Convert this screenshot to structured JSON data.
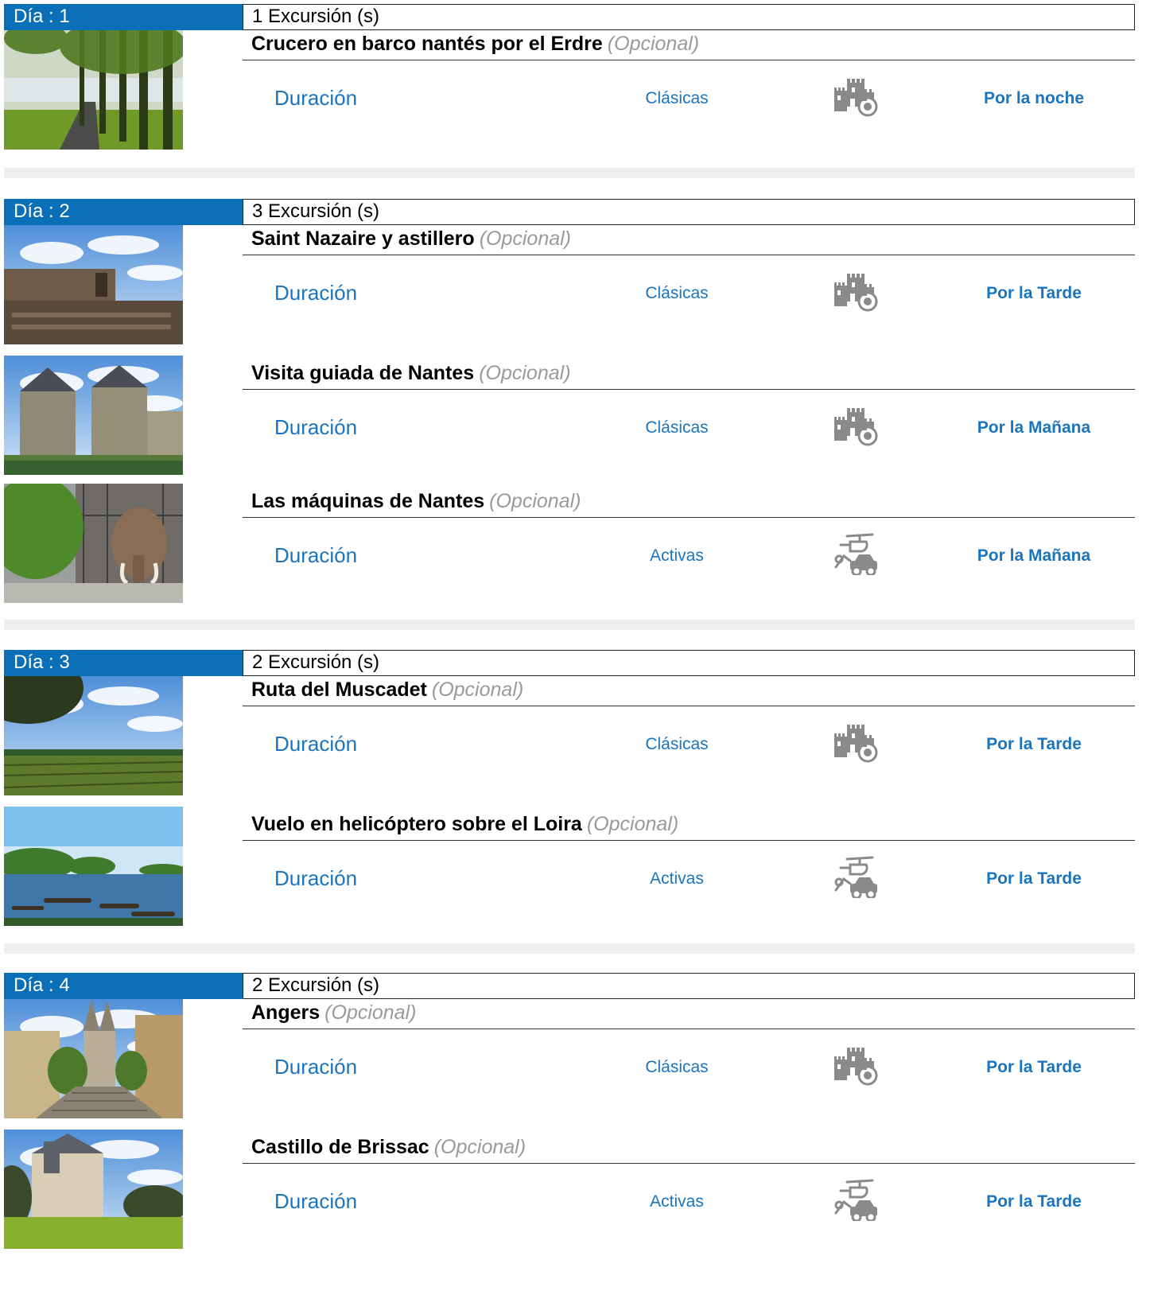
{
  "days": [
    {
      "label": "Día : 1",
      "count": "1 Excursión (s)",
      "excursions": [
        {
          "name": "Crucero en barco nantés por el Erdre",
          "optional": "(Opcional)",
          "duration": "Duración",
          "category": "Clásicas",
          "category_icon": "castle-camera-icon",
          "time": "Por la noche",
          "image": "river-path-trees"
        }
      ]
    },
    {
      "label": "Día : 2",
      "count": "3 Excursión (s)",
      "excursions": [
        {
          "name": "Saint Nazaire y astillero",
          "optional": "(Opcional)",
          "duration": "Duración",
          "category": "Clásicas",
          "category_icon": "castle-camera-icon",
          "time": "Por la Tarde",
          "image": "bunker-sky"
        },
        {
          "name": "Visita guiada de Nantes",
          "optional": "(Opcional)",
          "duration": "Duración",
          "category": "Clásicas",
          "category_icon": "castle-camera-icon",
          "time": "Por la Mañana",
          "image": "castle-moat"
        },
        {
          "name": "Las máquinas de Nantes",
          "optional": "(Opcional)",
          "duration": "Duración",
          "category": "Activas",
          "category_icon": "helicopter-car-icon",
          "time": "Por la Mañana",
          "image": "mechanical-elephant"
        }
      ]
    },
    {
      "label": "Día : 3",
      "count": "2 Excursión (s)",
      "excursions": [
        {
          "name": "Ruta del Muscadet",
          "optional": "(Opcional)",
          "duration": "Duración",
          "category": "Clásicas",
          "category_icon": "castle-camera-icon",
          "time": "Por la Tarde",
          "image": "vineyard-sky"
        },
        {
          "name": "Vuelo en helicóptero sobre el Loira",
          "optional": "(Opcional)",
          "duration": "Duración",
          "category": "Activas",
          "category_icon": "helicopter-car-icon",
          "time": "Por la Tarde",
          "image": "loire-river-boats"
        }
      ]
    },
    {
      "label": "Día : 4",
      "count": "2 Excursión (s)",
      "excursions": [
        {
          "name": "Angers",
          "optional": "(Opcional)",
          "duration": "Duración",
          "category": "Clásicas",
          "category_icon": "castle-camera-icon",
          "time": "Por la Tarde",
          "image": "angers-cathedral-stairs"
        },
        {
          "name": "Castillo de Brissac",
          "optional": "(Opcional)",
          "duration": "Duración",
          "category": "Activas",
          "category_icon": "helicopter-car-icon",
          "time": "Por la Tarde",
          "image": "brissac-castle-lawn"
        }
      ]
    }
  ]
}
